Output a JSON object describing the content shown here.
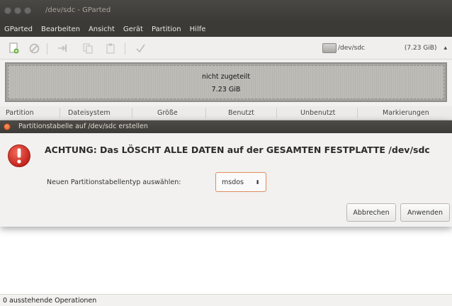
{
  "window": {
    "title": "/dev/sdc - GParted"
  },
  "menubar": {
    "items": [
      "GParted",
      "Bearbeiten",
      "Ansicht",
      "Gerät",
      "Partition",
      "Hilfe"
    ]
  },
  "toolbar": {
    "icons": [
      "new-icon",
      "delete-icon",
      "resize-icon",
      "copy-icon",
      "paste-icon",
      "apply-icon"
    ],
    "device": {
      "name": "/dev/sdc",
      "size": "(7.23 GiB)"
    }
  },
  "diskmap": {
    "label": "nicht zugeteilt",
    "size": "7.23 GiB"
  },
  "columns": [
    "Partition",
    "Dateisystem",
    "Größe",
    "Benutzt",
    "Unbenutzt",
    "Markierungen"
  ],
  "dialog": {
    "title": "Partitionstabelle auf /dev/sdc erstellen",
    "heading": "ACHTUNG:  Das LÖSCHT ALLE DATEN auf der GESAMTEN FESTPLATTE /dev/sdc",
    "type_label": "Neuen Partitionstabellentyp auswählen:",
    "type_value": "msdos",
    "cancel_label": "Abbrechen",
    "apply_label": "Anwenden"
  },
  "statusbar": {
    "text": "0 ausstehende Operationen"
  },
  "colors": {
    "titlebar": "#3b3a36",
    "accent_orange": "#e38b5a",
    "warning_red": "#d32f2f"
  }
}
